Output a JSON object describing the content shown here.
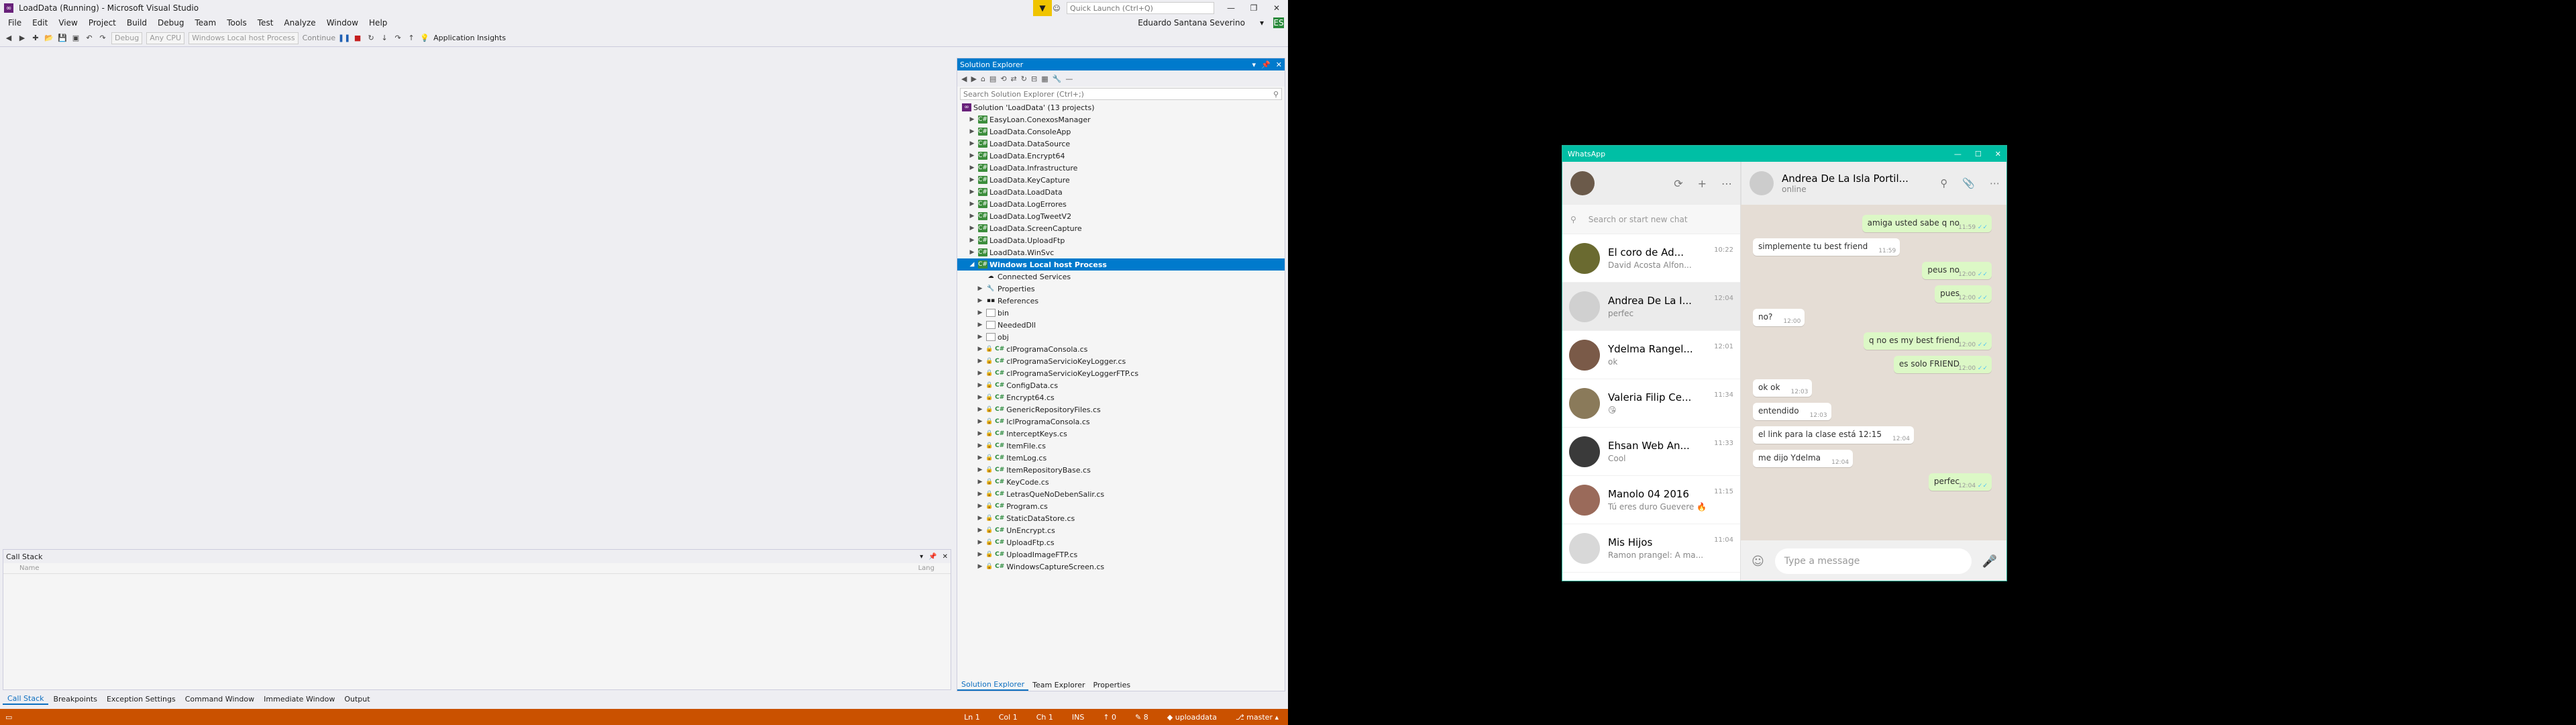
{
  "vs": {
    "title": "LoadData (Running) - Microsoft Visual Studio",
    "quick_launch": "Quick Launch (Ctrl+Q)",
    "menu": [
      "File",
      "Edit",
      "View",
      "Project",
      "Build",
      "Debug",
      "Team",
      "Tools",
      "Test",
      "Analyze",
      "Window",
      "Help"
    ],
    "user": "Eduardo Santana Severino",
    "user_initial": "ES",
    "toolbar": {
      "config": "Debug",
      "platform": "Any CPU",
      "process": "Windows Local host Process",
      "continue": "Continue",
      "insights": "Application Insights"
    },
    "callstack": {
      "title": "Call Stack",
      "col_name": "Name",
      "col_lang": "Lang"
    },
    "bottom_tabs": [
      "Call Stack",
      "Breakpoints",
      "Exception Settings",
      "Command Window",
      "Immediate Window",
      "Output"
    ],
    "status": {
      "ln": "Ln 1",
      "col": "Col 1",
      "ch": "Ch 1",
      "ins": "INS",
      "up": "0",
      "pencil": "8",
      "repo": "uploaddata",
      "branch": "master"
    }
  },
  "se": {
    "title": "Solution Explorer",
    "search": "Search Solution Explorer (Ctrl+;)",
    "solution": "Solution 'LoadData' (13 projects)",
    "projects": [
      "EasyLoan.ConexosManager",
      "LoadData.ConsoleApp",
      "LoadData.DataSource",
      "LoadData.Encrypt64",
      "LoadData.Infrastructure",
      "LoadData.KeyCapture",
      "LoadData.LoadData",
      "LoadData.LogErrores",
      "LoadData.LogTweetV2",
      "LoadData.ScreenCapture",
      "LoadData.UploadFtp",
      "LoadData.WinSvc"
    ],
    "selected_project": "Windows Local host Process",
    "children": [
      "Connected Services",
      "Properties",
      "References",
      "bin",
      "NeededDll",
      "obj",
      "clProgramaConsola.cs",
      "clProgramaServicioKeyLogger.cs",
      "clProgramaServicioKeyLoggerFTP.cs",
      "ConfigData.cs",
      "Encrypt64.cs",
      "GenericRepositoryFiles.cs",
      "IclProgramaConsola.cs",
      "InterceptKeys.cs",
      "ItemFile.cs",
      "ItemLog.cs",
      "ItemRepositoryBase.cs",
      "KeyCode.cs",
      "LetrasQueNoDebenSalir.cs",
      "Program.cs",
      "StaticDataStore.cs",
      "UnEncrypt.cs",
      "UploadFtp.cs",
      "UploadImageFTP.cs",
      "WindowsCaptureScreen.cs"
    ],
    "footer_tabs": [
      "Solution Explorer",
      "Team Explorer",
      "Properties"
    ]
  },
  "wa": {
    "title": "WhatsApp",
    "search": "Search or start new chat",
    "chats": [
      {
        "name": "El coro de Ad...",
        "time": "10:22",
        "preview": "David Acosta Alfon...",
        "color": "#6a6a30"
      },
      {
        "name": "Andrea De La I...",
        "time": "12:04",
        "preview": "perfec",
        "color": "#d0d0d0"
      },
      {
        "name": "Ydelma Rangel...",
        "time": "12:01",
        "preview": "ok",
        "color": "#7a5a48"
      },
      {
        "name": "Valeria Filip Ce...",
        "time": "11:34",
        "preview": "😘",
        "color": "#8a7a5a"
      },
      {
        "name": "Ehsan Web An...",
        "time": "11:33",
        "preview": "Cool",
        "color": "#3a3a3a"
      },
      {
        "name": "Manolo 04 2016",
        "time": "11:15",
        "preview": "Tú eres duro Guevere 🔥",
        "color": "#9a6a5a"
      },
      {
        "name": "Mis Hijos",
        "time": "11:04",
        "preview": "Ramon prangel: A ma...",
        "color": "#d8d8d8"
      }
    ],
    "contact": {
      "name": "Andrea De La Isla Portil...",
      "status": "online"
    },
    "messages": [
      {
        "dir": "out",
        "text": "amiga usted sabe q no",
        "time": "11:59"
      },
      {
        "dir": "in",
        "text": "simplemente tu best friend",
        "time": "11:59"
      },
      {
        "dir": "out",
        "text": "peus no",
        "time": "12:00"
      },
      {
        "dir": "out",
        "text": "pues",
        "time": "12:00"
      },
      {
        "dir": "in",
        "text": "no?",
        "time": "12:00"
      },
      {
        "dir": "out",
        "text": "q no es my best friend",
        "time": "12:00"
      },
      {
        "dir": "out",
        "text": "es solo FRIEND",
        "time": "12:00"
      },
      {
        "dir": "in",
        "text": "ok ok",
        "time": "12:03"
      },
      {
        "dir": "in",
        "text": "entendido",
        "time": "12:03"
      },
      {
        "dir": "in",
        "text": "el link para la clase está 12:15",
        "time": "12:04"
      },
      {
        "dir": "in",
        "text": "me dijo Ydelma",
        "time": "12:04"
      },
      {
        "dir": "out",
        "text": "perfec",
        "time": "12:04"
      }
    ],
    "compose": "Type a message"
  }
}
